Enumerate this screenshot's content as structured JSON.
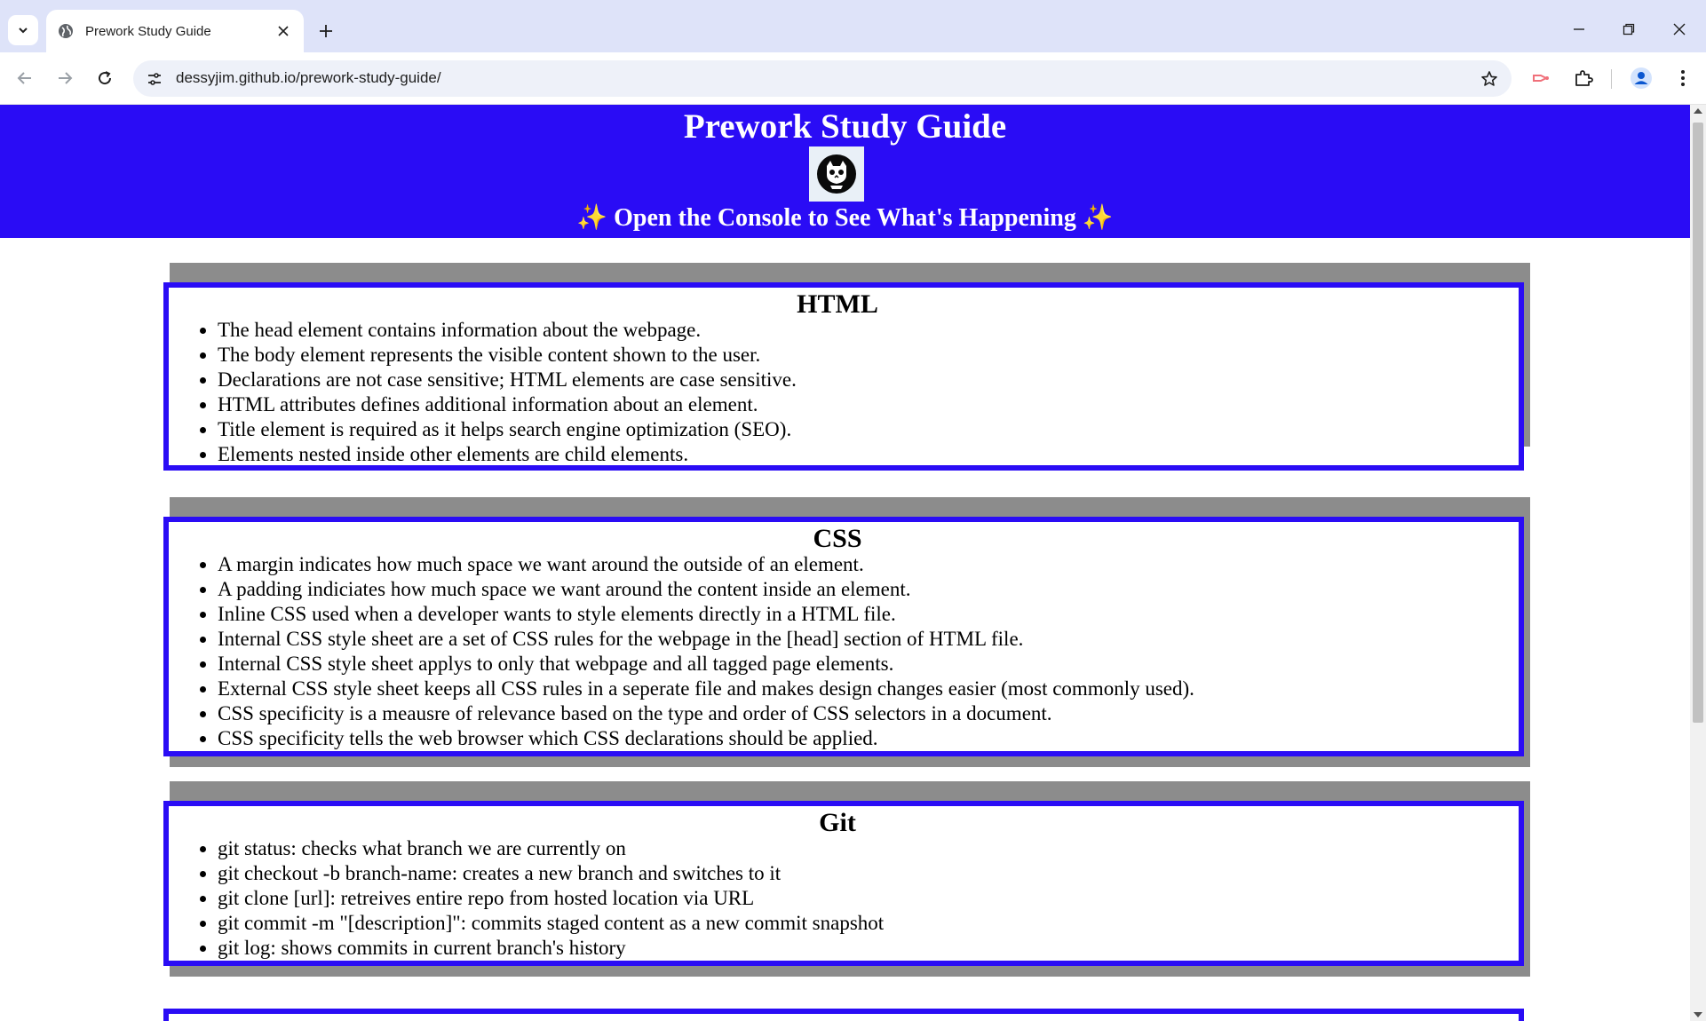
{
  "browser": {
    "tab_title": "Prework Study Guide",
    "url": "dessyjim.github.io/prework-study-guide/",
    "icons": {
      "tab_search": "chevron-down-icon",
      "favicon": "globe-icon",
      "tab_close": "close-icon",
      "new_tab": "plus-icon",
      "minimize": "minimize-icon",
      "restore": "restore-icon",
      "close_window": "close-icon",
      "back": "back-arrow-icon",
      "forward": "forward-arrow-icon",
      "reload": "reload-icon",
      "site_info": "tune-icon",
      "bookmark": "star-icon",
      "extension_1": "cast-icon",
      "extensions": "puzzle-icon",
      "profile": "profile-icon",
      "menu": "kebab-menu-icon"
    }
  },
  "page": {
    "header": {
      "title": "Prework Study Guide",
      "subtitle": "Open the Console to See What's Happening",
      "sparkle": "✨",
      "avatar_icon": "cat-skull-avatar-icon"
    },
    "colors": {
      "header_bg": "#2a0cf5",
      "card_border": "#2a0cf5",
      "card_shadow": "#8c8c8c",
      "sparkle": "#f6c546"
    },
    "sections": [
      {
        "title": "HTML",
        "items": [
          "The head element contains information about the webpage.",
          "The body element represents the visible content shown to the user.",
          "Declarations are not case sensitive; HTML elements are case sensitive.",
          "HTML attributes defines additional information about an element.",
          "Title element is required as it helps search engine optimization (SEO).",
          "Elements nested inside other elements are child elements."
        ]
      },
      {
        "title": "CSS",
        "items": [
          "A margin indicates how much space we want around the outside of an element.",
          "A padding indiciates how much space we want around the content inside an element.",
          "Inline CSS used when a developer wants to style elements directly in a HTML file.",
          "Internal CSS style sheet are a set of CSS rules for the webpage in the [head] section of HTML file.",
          "Internal CSS style sheet applys to only that webpage and all tagged page elements.",
          "External CSS style sheet keeps all CSS rules in a seperate file and makes design changes easier (most commonly used).",
          "CSS specificity is a meausre of relevance based on the type and order of CSS selectors in a document.",
          "CSS specificity tells the web browser which CSS declarations should be applied."
        ]
      },
      {
        "title": "Git",
        "items": [
          "git status: checks what branch we are currently on",
          "git checkout -b branch-name: creates a new branch and switches to it",
          "git clone [url]: retreives entire repo from hosted location via URL",
          "git commit -m \"[description]\": commits staged content as a new commit snapshot",
          "git log: shows commits in current branch's history"
        ]
      }
    ]
  }
}
